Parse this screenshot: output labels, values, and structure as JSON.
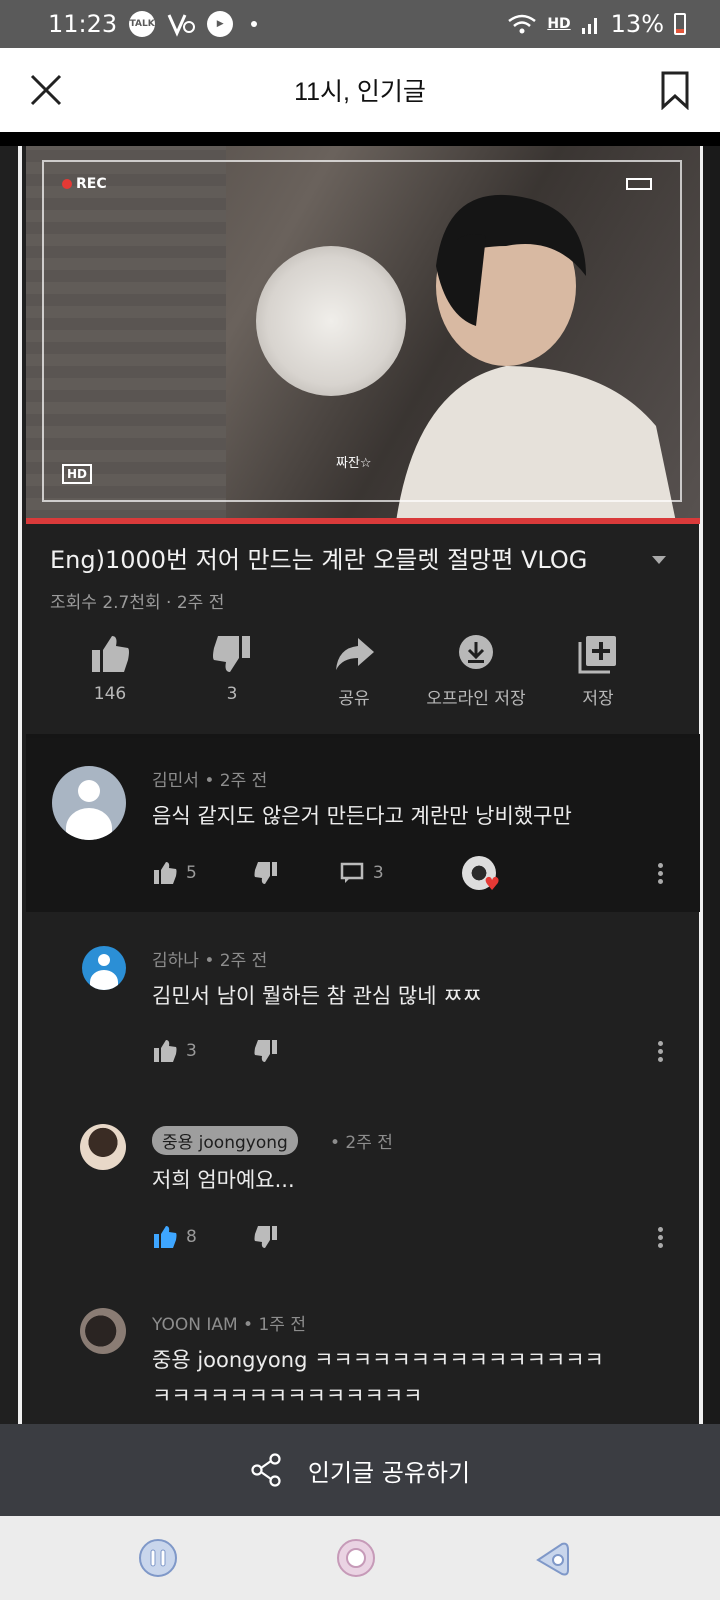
{
  "status_bar": {
    "time": "11:23",
    "talk_icon_label": "TALK",
    "network": "HD",
    "battery": "13%",
    "icons": [
      "talk-icon",
      "vlive-icon",
      "vpn-icon",
      "wifi-icon",
      "hd-voice-icon",
      "signal-icon",
      "battery-icon"
    ]
  },
  "app_bar": {
    "title": "11시, 인기글",
    "icons": [
      "close-icon",
      "bookmark-icon"
    ]
  },
  "screenshot": {
    "video": {
      "rec_label": "REC",
      "hd_label": "HD",
      "caption": "짜잔☆"
    },
    "title": "Eng)1000번 저어 만드는 계란 오믈렛 절망편 VLOG",
    "meta": "조회수 2.7천회 · 2주 전",
    "actions": [
      {
        "icon": "thumbs-up-icon",
        "label": "146"
      },
      {
        "icon": "thumbs-down-icon",
        "label": "3"
      },
      {
        "icon": "share-icon",
        "label": "공유"
      },
      {
        "icon": "download-icon",
        "label": "오프라인 저장"
      },
      {
        "icon": "add-to-playlist-icon",
        "label": "저장"
      }
    ],
    "comments": [
      {
        "author": "김민서 • 2주 전",
        "text": "음식 같지도 않은거 만든다고 계란만 낭비했구만",
        "likes": "5",
        "replies": "3"
      },
      {
        "author": "김하나 • 2주 전",
        "text": "김민서 남이 뭘하든 참 관심 많네 ㅉㅉ",
        "likes": "3"
      },
      {
        "author_chip": "중용 joongyong",
        "time": "• 2주 전",
        "text": "저희 엄마예요...",
        "likes": "8"
      },
      {
        "author": "YOON IAM • 1주 전",
        "text": "중용 joongyong ㅋㅋㅋㅋㅋㅋㅋㅋㅋㅋㅋㅋㅋㅋㅋ",
        "text2": "ㅋㅋㅋㅋㅋㅋㅋㅋㅋㅋㅋㅋㅋㅋ"
      }
    ]
  },
  "share_bar": {
    "label": "인기글 공유하기",
    "icon": "share-nodes-icon"
  },
  "nav_bar": {
    "icons": [
      "recents-icon",
      "home-icon",
      "back-icon"
    ]
  },
  "colors": {
    "status_bar": "#5a5a5a",
    "share_bar": "#3b3d42",
    "rec_red": "#e53935",
    "like_blue": "#3ea6ff"
  }
}
